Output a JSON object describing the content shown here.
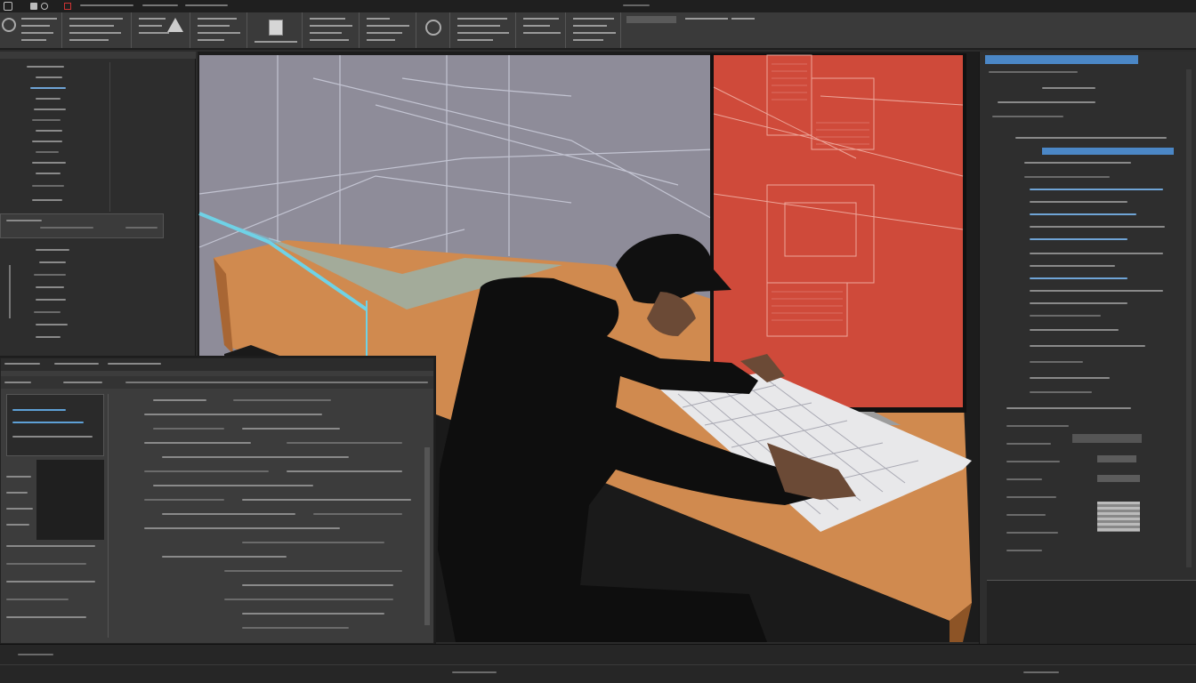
{
  "ribbon": {
    "groups": 12,
    "tab_active": "",
    "accent": "#4b87c6"
  },
  "scene": {
    "wall_color": "#8e8c99",
    "desk_color": "#d08a4f",
    "screen_color": "#cf4a3a",
    "person_color": "#0e0e0e",
    "highlight_color": "#6fd2e6",
    "icons": [
      "person-figure",
      "monitor",
      "keyboard",
      "desk",
      "wireframe"
    ]
  },
  "colors": {
    "panel": "#2d2d2d",
    "panel_light": "#3c3c3c",
    "selection": "#4b87c6"
  }
}
